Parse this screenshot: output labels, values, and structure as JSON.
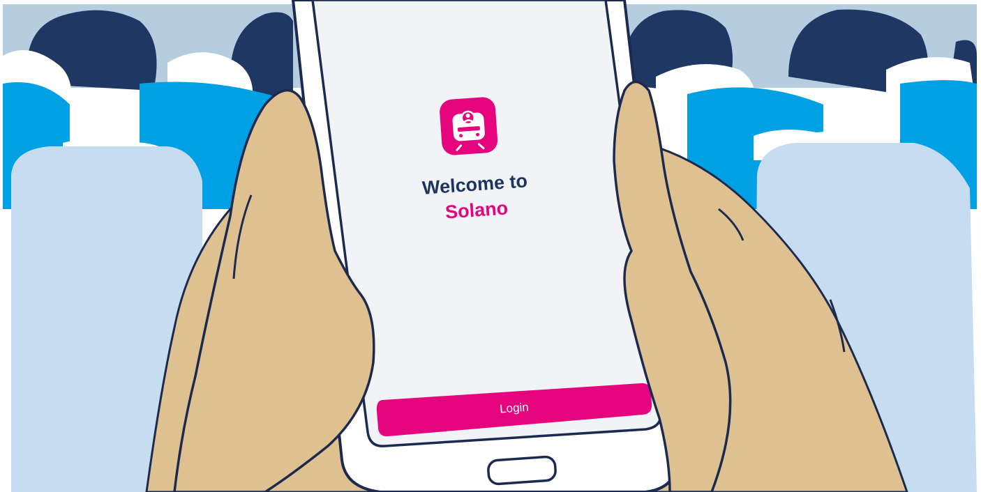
{
  "app": {
    "welcome_line1": "Welcome to",
    "welcome_line2": "Solano",
    "login_label": "Login",
    "logo_icon": "train-icon"
  },
  "colors": {
    "brand_pink": "#e5047e",
    "heading_navy": "#1b355f",
    "seat_blue": "#00a1e4",
    "seat_light": "#c6dcf0",
    "head_dark": "#1e3763",
    "skin": "#dfc090",
    "outline": "#1b2a4e",
    "screen_bg": "#f1f3f7",
    "sky": "#b6cde0"
  }
}
